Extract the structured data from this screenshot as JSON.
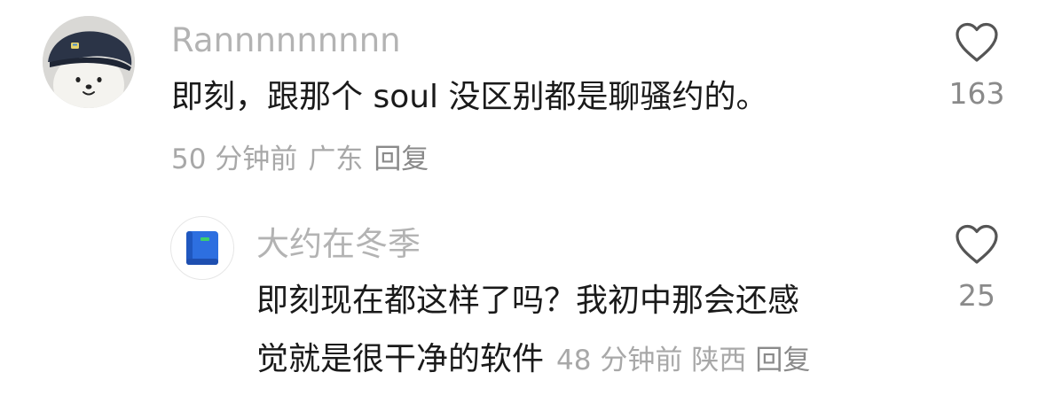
{
  "comment": {
    "username": "Rannnnnnnnn",
    "text": "即刻，跟那个 soul 没区别都是聊骚约的。",
    "time": "50 分钟前",
    "location": "广东",
    "reply_label": "回复",
    "like_count": "163",
    "avatar_icon": "bear-beret-avatar",
    "like_icon": "heart-outline-icon"
  },
  "reply": {
    "username": "大约在冬季",
    "text_line1": "即刻现在都这样了吗？我初中那会还感",
    "text_line2": "觉就是很干净的软件",
    "time": "48 分钟前",
    "location": "陕西",
    "reply_label": "回复",
    "like_count": "25",
    "avatar_icon": "blue-book-avatar",
    "like_icon": "heart-outline-icon"
  },
  "colors": {
    "username": "#b3b3b3",
    "text": "#1a1a1a",
    "meta": "#a8a8a8",
    "book_blue": "#2d6fe0",
    "book_green": "#3ccf6e"
  }
}
